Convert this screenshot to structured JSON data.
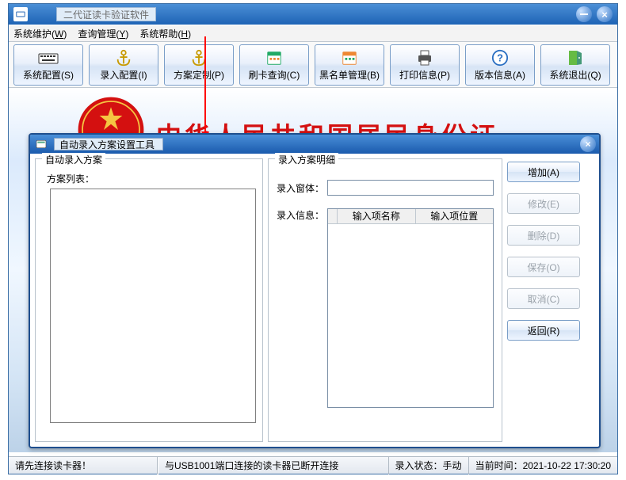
{
  "window": {
    "title": "二代证读卡验证软件"
  },
  "menu": {
    "items": [
      {
        "label": "系统维护",
        "hotkey": "W"
      },
      {
        "label": "查询管理",
        "hotkey": "Y"
      },
      {
        "label": "系统帮助",
        "hotkey": "H"
      }
    ]
  },
  "toolbar": {
    "items": [
      {
        "key": "system-config",
        "label": "系统配置(S)"
      },
      {
        "key": "input-config",
        "label": "录入配置(I)"
      },
      {
        "key": "plan-custom",
        "label": "方案定制(P)"
      },
      {
        "key": "card-query",
        "label": "刷卡查询(C)"
      },
      {
        "key": "blacklist",
        "label": "黑名单管理(B)"
      },
      {
        "key": "print-info",
        "label": "打印信息(P)"
      },
      {
        "key": "version-info",
        "label": "版本信息(A)"
      },
      {
        "key": "system-exit",
        "label": "系统退出(Q)"
      }
    ]
  },
  "banner": {
    "text": "中华人民共和国居民身份证"
  },
  "dialog": {
    "title": "自动录入方案设置工具",
    "groups": {
      "left_title": "自动录入方案",
      "right_title": "录入方案明细",
      "list_label": "方案列表：",
      "window_label": "录入窗体：",
      "info_label": "录入信息：",
      "th1": "输入项名称",
      "th2": "输入项位置"
    },
    "buttons": {
      "add": "增加(A)",
      "edit": "修改(E)",
      "delete": "删除(D)",
      "save": "保存(O)",
      "cancel": "取消(C)",
      "return": "返回(R)"
    }
  },
  "statusbar": {
    "left": "请先连接读卡器！",
    "mid": "与USB1001端口连接的读卡器已断开连接",
    "mode": "录入状态：手动",
    "time": "当前时间：2021-10-22 17:30:20"
  }
}
